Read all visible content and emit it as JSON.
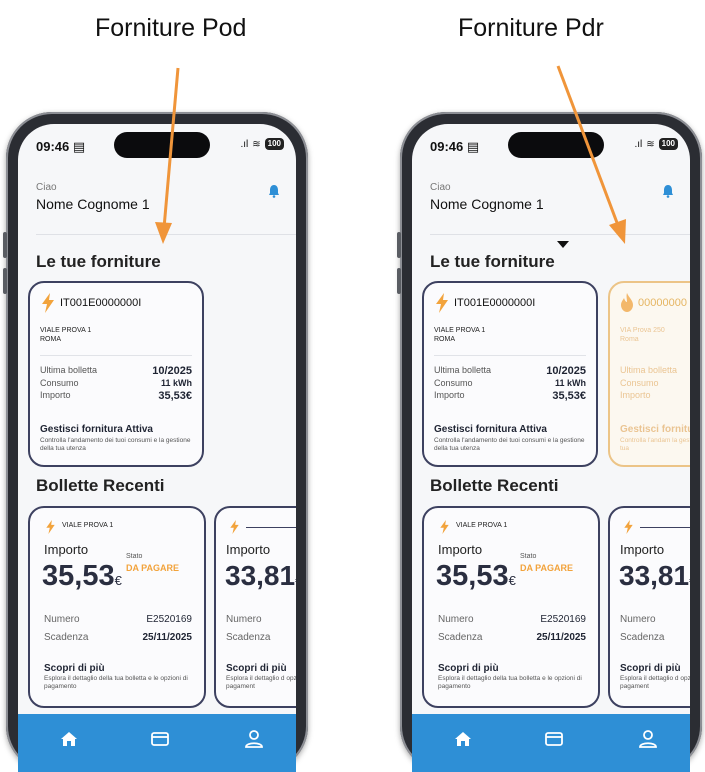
{
  "captions": {
    "left": "Forniture Pod",
    "right": "Forniture Pdr"
  },
  "colors": {
    "accent": "#f2a33c",
    "tabbar": "#2e8fd6",
    "card_border": "#3d4160",
    "arrow": "#f0953a"
  },
  "phones": [
    {
      "status": {
        "time": "09:46",
        "battery": "100"
      },
      "greeting": {
        "small": "Ciao",
        "name": "Nome Cognome 1"
      },
      "supplies_title": "Le tue forniture",
      "supply_card": {
        "code": "IT001E0000000I",
        "address_line1": "VIALE PROVA 1",
        "address_line2": "ROMA",
        "rows": [
          {
            "label": "Ultima bolletta",
            "value": "10/2025"
          },
          {
            "label": "Consumo",
            "value": "11 kWh"
          },
          {
            "label": "Importo",
            "value": "35,53€"
          }
        ],
        "manage_title": "Gestisci fornitura Attiva",
        "manage_desc": "Controlla l'andamento dei tuoi consumi e la gestione della tua utenza"
      },
      "bills_title": "Bollette Recenti",
      "bill_card": {
        "address": "VIALE PROVA 1",
        "amount_label": "Importo",
        "amount": "35,53",
        "currency": "€",
        "status_label": "Stato",
        "status": "DA PAGARE",
        "rows": [
          {
            "label": "Numero",
            "value": "E2520169"
          },
          {
            "label": "Scadenza",
            "value": "25/11/2025"
          }
        ],
        "more_title": "Scopri di più",
        "more_desc": "Esplora il dettaglio della tua bolletta e le opzioni di pagamento"
      },
      "bill_card2": {
        "amount_label": "Importo",
        "amount": "33,81",
        "currency": "€",
        "rows": [
          {
            "label": "Numero"
          },
          {
            "label": "Scadenza"
          }
        ],
        "more_title": "Scopri di più",
        "more_desc": "Esplora il dettaglio d opzioni di pagament"
      },
      "tabs": [
        "home-icon",
        "card-icon",
        "user-icon"
      ]
    },
    {
      "status": {
        "time": "09:46",
        "battery": "100"
      },
      "greeting": {
        "small": "Ciao",
        "name": "Nome Cognome 1"
      },
      "supplies_title": "Le tue forniture",
      "supply_card": {
        "code": "IT001E0000000I",
        "address_line1": "VIALE PROVA 1",
        "address_line2": "ROMA",
        "rows": [
          {
            "label": "Ultima bolletta",
            "value": "10/2025"
          },
          {
            "label": "Consumo",
            "value": "11 kWh"
          },
          {
            "label": "Importo",
            "value": "35,53€"
          }
        ],
        "manage_title": "Gestisci fornitura Attiva",
        "manage_desc": "Controlla l'andamento dei tuoi consumi e la gestione della tua utenza"
      },
      "gas_card": {
        "code": "00000000",
        "address": "VIA Prova 250",
        "city": "Roma",
        "rows": [
          {
            "label": "Ultima bolletta"
          },
          {
            "label": "Consumo"
          },
          {
            "label": "Importo"
          }
        ],
        "manage_title": "Gestisci fornitu",
        "manage_desc": "Controlla l'andam la gestione della tua"
      },
      "bills_title": "Bollette Recenti",
      "bill_card": {
        "address": "VIALE PROVA 1",
        "amount_label": "Importo",
        "amount": "35,53",
        "currency": "€",
        "status_label": "Stato",
        "status": "DA PAGARE",
        "rows": [
          {
            "label": "Numero",
            "value": "E2520169"
          },
          {
            "label": "Scadenza",
            "value": "25/11/2025"
          }
        ],
        "more_title": "Scopri di più",
        "more_desc": "Esplora il dettaglio della tua bolletta e le opzioni di pagamento"
      },
      "bill_card2": {
        "amount_label": "Importo",
        "amount": "33,81",
        "currency": "€",
        "rows": [
          {
            "label": "Numero"
          },
          {
            "label": "Scadenza"
          }
        ],
        "more_title": "Scopri di più",
        "more_desc": "Esplora il dettaglio d opzioni di pagament"
      },
      "tabs": [
        "home-icon",
        "card-icon",
        "user-icon"
      ]
    }
  ]
}
